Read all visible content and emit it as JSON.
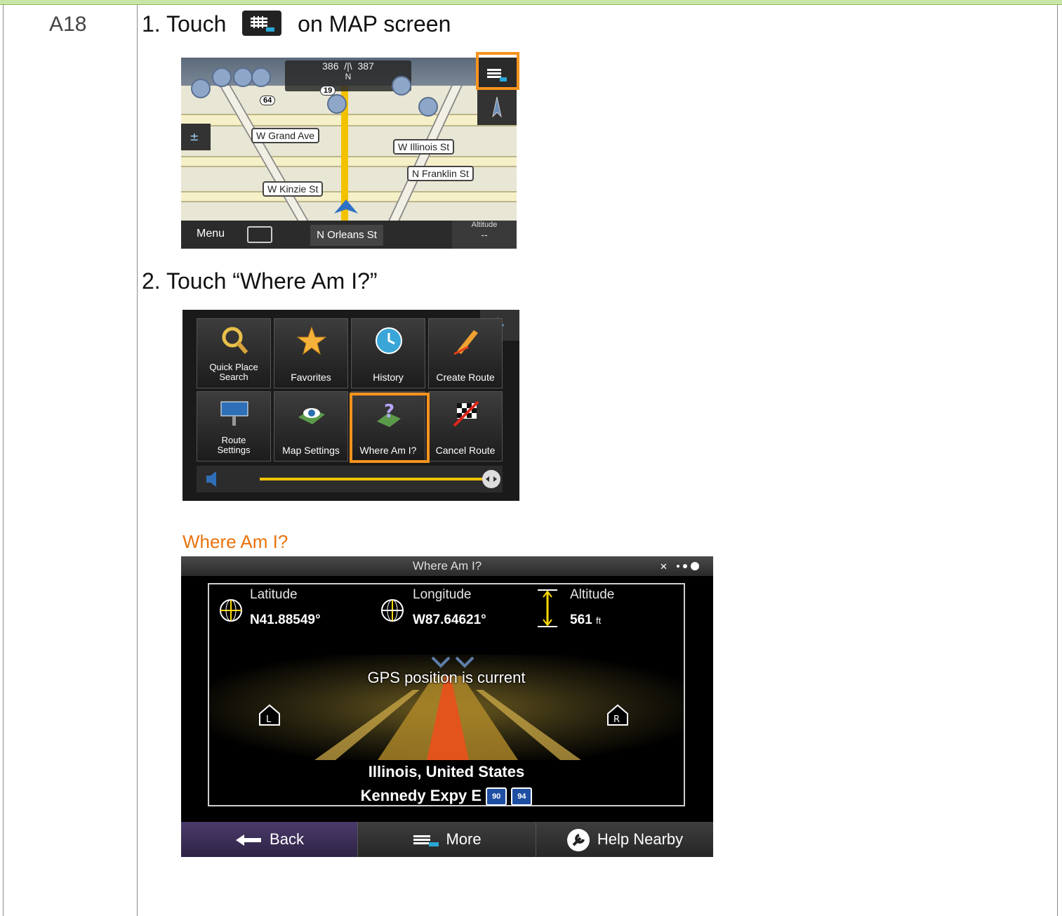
{
  "row_id": "A18",
  "step1": {
    "number": "1.",
    "before": "Touch",
    "after": "on MAP screen"
  },
  "step2": {
    "text": "2.  Touch “Where Am I?”"
  },
  "map_screen": {
    "compass_left": "386",
    "compass_right": "387",
    "compass_heading": "N",
    "shield_64": "64",
    "shield_19": "19",
    "streets": [
      "W Grand Ave",
      "W Illinois St",
      "N Franklin St",
      "W Kinzie St"
    ],
    "menu_label": "Menu",
    "current_street": "N Orleans St",
    "altitude_label": "Altitude",
    "altitude_value": "--",
    "more_icon": "grid-arrow-icon"
  },
  "menu_screen": {
    "tiles": [
      {
        "label": "Quick Place\nSearch",
        "icon": "magnifier-icon"
      },
      {
        "label": "Favorites",
        "icon": "star-icon"
      },
      {
        "label": "History",
        "icon": "clock-icon"
      },
      {
        "label": "Create Route",
        "icon": "pencil-icon"
      },
      {
        "label": "Route\nSettings",
        "icon": "road-sign-icon"
      },
      {
        "label": "Map Settings",
        "icon": "eye-map-icon"
      },
      {
        "label": "Where Am I?",
        "icon": "question-map-icon"
      },
      {
        "label": "Cancel Route",
        "icon": "checkered-flag-icon"
      }
    ]
  },
  "where_am_i": {
    "caption": "Where Am I?",
    "title": "Where Am I?",
    "latitude_label": "Latitude",
    "latitude_value": "N41.88549°",
    "longitude_label": "Longitude",
    "longitude_value": "W87.64621°",
    "altitude_label": "Altitude",
    "altitude_value": "561",
    "altitude_unit": "ft",
    "gps_status": "GPS position is current",
    "location": "Illinois, United States",
    "road": "Kennedy Expy E",
    "shield_a": "90",
    "shield_b": "94",
    "back": "Back",
    "more": "More",
    "help": "Help Nearby"
  },
  "colors": {
    "accent": "#f7931e",
    "caption": "#e8730d",
    "topbar": "#c9e6a7"
  }
}
